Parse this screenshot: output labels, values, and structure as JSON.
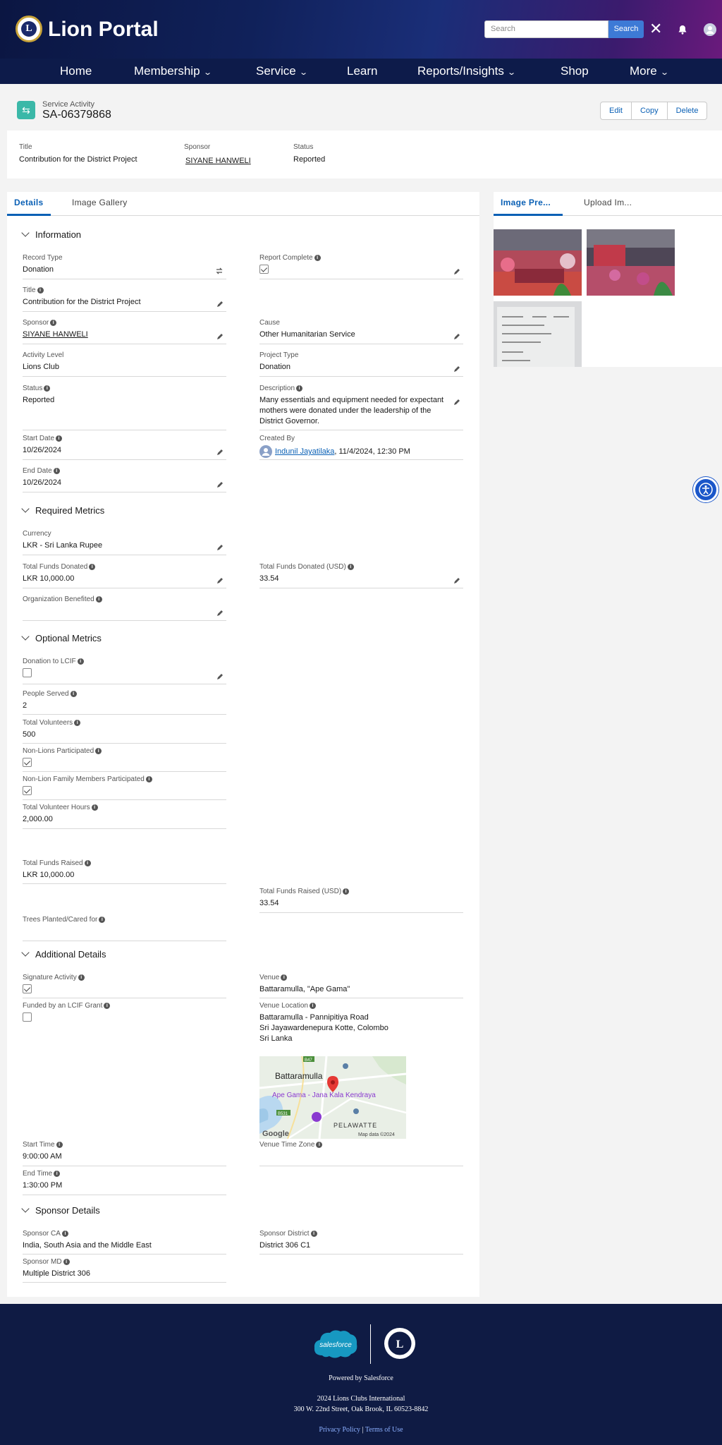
{
  "header": {
    "brand": "Lion Portal",
    "search_placeholder": "Search",
    "search_button": "Search"
  },
  "nav": {
    "items": [
      {
        "label": "Home",
        "dropdown": false
      },
      {
        "label": "Membership",
        "dropdown": true
      },
      {
        "label": "Service",
        "dropdown": true
      },
      {
        "label": "Learn",
        "dropdown": false
      },
      {
        "label": "Reports/Insights",
        "dropdown": true
      },
      {
        "label": "Shop",
        "dropdown": false
      },
      {
        "label": "More",
        "dropdown": true
      }
    ]
  },
  "record": {
    "type_label": "Service Activity",
    "name": "SA-06379868",
    "actions": [
      "Edit",
      "Copy",
      "Delete"
    ]
  },
  "highlights": [
    {
      "label": "Title",
      "value": "Contribution for the District Project",
      "link": false
    },
    {
      "label": "Sponsor",
      "value": "SIYANE HANWELI",
      "link": true
    },
    {
      "label": "Status",
      "value": "Reported",
      "link": false
    }
  ],
  "tabs": [
    "Details",
    "Image Gallery"
  ],
  "sections": {
    "information": "Information",
    "required": "Required Metrics",
    "optional": "Optional Metrics",
    "additional": "Additional Details",
    "sponsor": "Sponsor Details"
  },
  "fields": {
    "record_type": {
      "label": "Record Type",
      "value": "Donation"
    },
    "report_complete": {
      "label": "Report Complete",
      "checked": true
    },
    "title": {
      "label": "Title",
      "value": "Contribution for the District Project"
    },
    "sponsor": {
      "label": "Sponsor",
      "value": "SIYANE HANWELI"
    },
    "cause": {
      "label": "Cause",
      "value": "Other Humanitarian Service"
    },
    "activity_level": {
      "label": "Activity Level",
      "value": "Lions Club"
    },
    "project_type": {
      "label": "Project Type",
      "value": "Donation"
    },
    "status": {
      "label": "Status",
      "value": "Reported"
    },
    "description": {
      "label": "Description",
      "value": "Many essentials and equipment needed for expectant mothers were donated under the leadership of the District Governor."
    },
    "start_date": {
      "label": "Start Date",
      "value": "10/26/2024"
    },
    "created_by": {
      "label": "Created By",
      "user": "Indunil Jayatilaka",
      "date": ", 11/4/2024, 12:30 PM"
    },
    "end_date": {
      "label": "End Date",
      "value": "10/26/2024"
    },
    "currency": {
      "label": "Currency",
      "value": "LKR - Sri Lanka Rupee"
    },
    "total_funds_donated": {
      "label": "Total Funds Donated",
      "value": "LKR 10,000.00"
    },
    "total_funds_donated_usd": {
      "label": "Total Funds Donated (USD)",
      "value": "33.54"
    },
    "org_benefited": {
      "label": "Organization Benefited",
      "value": ""
    },
    "donation_lcif": {
      "label": "Donation to LCIF",
      "checked": false
    },
    "people_served": {
      "label": "People Served",
      "value": "2"
    },
    "total_volunteers": {
      "label": "Total Volunteers",
      "value": "500"
    },
    "non_lions": {
      "label": "Non-Lions Participated",
      "checked": true
    },
    "non_lion_family": {
      "label": "Non-Lion Family Members Participated",
      "checked": true
    },
    "total_volunteer_hours": {
      "label": "Total Volunteer Hours",
      "value": "2,000.00"
    },
    "total_funds_raised": {
      "label": "Total Funds Raised",
      "value": "LKR 10,000.00"
    },
    "total_funds_raised_usd": {
      "label": "Total Funds Raised (USD)",
      "value": "33.54"
    },
    "trees": {
      "label": "Trees Planted/Cared for",
      "value": ""
    },
    "signature_activity": {
      "label": "Signature Activity",
      "checked": true
    },
    "venue": {
      "label": "Venue",
      "value": "Battaramulla, \"Ape Gama\""
    },
    "funded_lcif": {
      "label": "Funded by an LCIF Grant",
      "checked": false
    },
    "venue_location": {
      "label": "Venue Location",
      "line1": "Battaramulla - Pannipitiya Road",
      "line2": "Sri Jayawardenepura Kotte, Colombo",
      "line3": "Sri Lanka"
    },
    "start_time": {
      "label": "Start Time",
      "value": "9:00:00 AM"
    },
    "venue_tz": {
      "label": "Venue Time Zone",
      "value": ""
    },
    "end_time": {
      "label": "End Time",
      "value": "1:30:00 PM"
    },
    "sponsor_ca": {
      "label": "Sponsor CA",
      "value": "India, South Asia and the Middle East"
    },
    "sponsor_district": {
      "label": "Sponsor District",
      "value": "District 306 C1"
    },
    "sponsor_md": {
      "label": "Sponsor MD",
      "value": "Multiple District 306"
    }
  },
  "map": {
    "town": "Battaramulla",
    "poi": "Ape Gama - Jana Kala Kendraya",
    "area": "PELAWATTE",
    "road1": "B47",
    "road2": "B531",
    "attribution": "Map data ©2024",
    "logo": "Google"
  },
  "right_panel": {
    "tabs": [
      "Image Pre...",
      "Upload Im..."
    ]
  },
  "footer": {
    "sf_logo": "salesforce",
    "powered": "Powered by Salesforce",
    "copyright": "2024 Lions Clubs International",
    "address": "300 W. 22nd Street, Oak Brook, IL 60523-8842",
    "privacy": "Privacy Policy",
    "sep": "|",
    "terms": "Terms of Use"
  }
}
